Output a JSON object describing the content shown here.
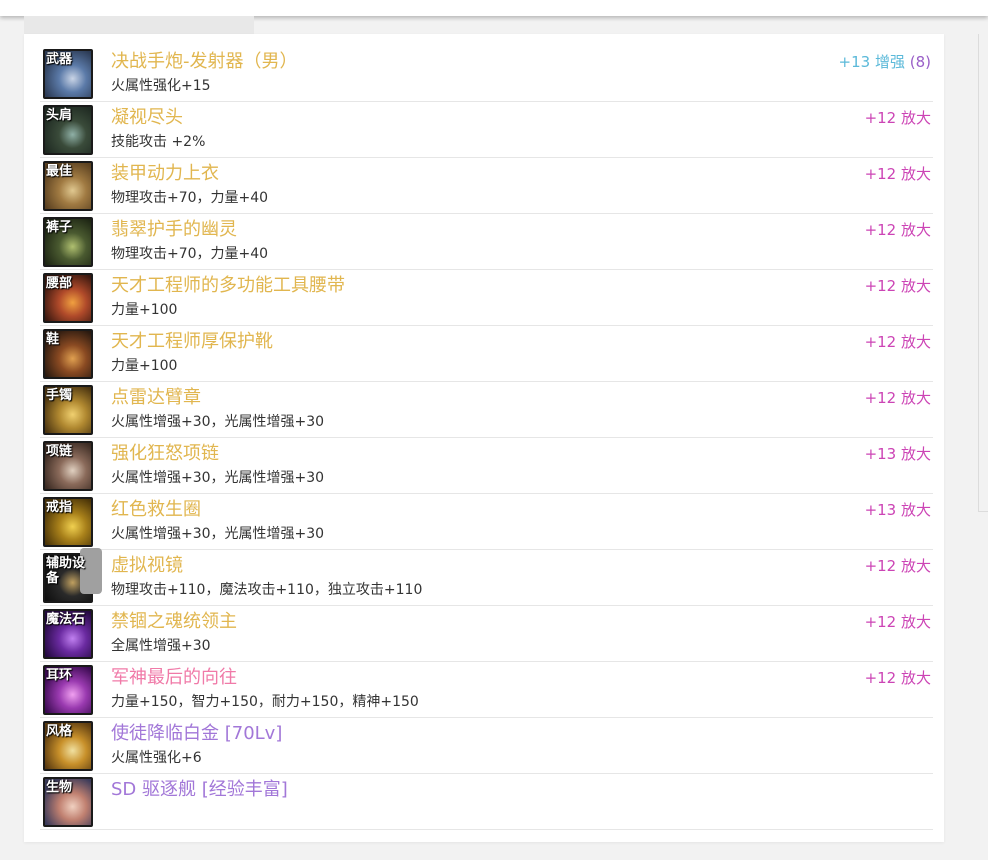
{
  "items": [
    {
      "slot": "武器",
      "name": "决战手炮-发射器（男）",
      "stat": "火属性强化+15",
      "enh_prefix": "+13 增强 ",
      "enh_count": "(8)",
      "name_color": "gold",
      "enh_color": "blue",
      "art": [
        "#5b7aa8",
        "#2c3b55",
        "#c9d4e6"
      ]
    },
    {
      "slot": "头肩",
      "name": "凝视尽头",
      "stat": "技能攻击 +2%",
      "enh_prefix": "+12 放大",
      "enh_count": "",
      "name_color": "gold",
      "enh_color": "magenta",
      "art": [
        "#3a4b3a",
        "#1f2a22",
        "#8fb0a6"
      ]
    },
    {
      "slot": "最佳",
      "name": "装甲动力上衣",
      "stat": "物理攻击+70，力量+40",
      "enh_prefix": "+12 放大",
      "enh_count": "",
      "name_color": "gold",
      "enh_color": "magenta",
      "art": [
        "#a07a42",
        "#5a4020",
        "#e0c890"
      ]
    },
    {
      "slot": "裤子",
      "name": "翡翠护手的幽灵",
      "stat": "物理攻击+70，力量+40",
      "enh_prefix": "+12 放大",
      "enh_count": "",
      "name_color": "gold",
      "enh_color": "magenta",
      "art": [
        "#4a5a30",
        "#1e2614",
        "#b0c070"
      ]
    },
    {
      "slot": "腰部",
      "name": "天才工程师的多功能工具腰带",
      "stat": "力量+100",
      "enh_prefix": "+12 放大",
      "enh_count": "",
      "name_color": "gold",
      "enh_color": "magenta",
      "art": [
        "#b04a2a",
        "#3a1810",
        "#f0a040"
      ]
    },
    {
      "slot": "鞋",
      "name": "天才工程师厚保护靴",
      "stat": "力量+100",
      "enh_prefix": "+12 放大",
      "enh_count": "",
      "name_color": "gold",
      "enh_color": "magenta",
      "art": [
        "#8a4a22",
        "#2a1a10",
        "#e0a050"
      ]
    },
    {
      "slot": "手镯",
      "name": "点雷达臂章",
      "stat": "火属性增强+30，光属性增强+30",
      "enh_prefix": "+12 放大",
      "enh_count": "",
      "name_color": "gold",
      "enh_color": "magenta",
      "art": [
        "#b08830",
        "#4a3410",
        "#f0d070"
      ]
    },
    {
      "slot": "项链",
      "name": "强化狂怒项链",
      "stat": "火属性增强+30，光属性增强+30",
      "enh_prefix": "+13 放大",
      "enh_count": "",
      "name_color": "gold",
      "enh_color": "magenta",
      "art": [
        "#8a6a5a",
        "#3a2a22",
        "#e0d0c0"
      ]
    },
    {
      "slot": "戒指",
      "name": "红色救生圈",
      "stat": "火属性增强+30，光属性增强+30",
      "enh_prefix": "+13 放大",
      "enh_count": "",
      "name_color": "gold",
      "enh_color": "magenta",
      "art": [
        "#a8801a",
        "#4a3408",
        "#f0d050"
      ]
    },
    {
      "slot": "辅助设备",
      "name": "虚拟视镜",
      "stat": "物理攻击+110，魔法攻击+110，独立攻击+110",
      "enh_prefix": "+12 放大",
      "enh_count": "",
      "name_color": "gold",
      "enh_color": "magenta",
      "art": [
        "#2a2a2a",
        "#101010",
        "#c0a060"
      ]
    },
    {
      "slot": "魔法石",
      "name": "禁锢之魂统领主",
      "stat": "全属性增强+30",
      "enh_prefix": "+12 放大",
      "enh_count": "",
      "name_color": "gold",
      "enh_color": "magenta",
      "art": [
        "#6a2aa0",
        "#240a40",
        "#c080f0"
      ]
    },
    {
      "slot": "耳环",
      "name": "军神最后的向往",
      "stat": "力量+150，智力+150，耐力+150，精神+150",
      "enh_prefix": "+12 放大",
      "enh_count": "",
      "name_color": "pink",
      "enh_color": "magenta",
      "art": [
        "#9a3ab0",
        "#3a0a50",
        "#f0a0f0"
      ]
    },
    {
      "slot": "风格",
      "name": "使徒降临白金 [70Lv]",
      "stat": "火属性强化+6",
      "enh_prefix": "",
      "enh_count": "",
      "name_color": "purple",
      "enh_color": "magenta",
      "art": [
        "#c8902a",
        "#5a3a10",
        "#f0e0a0"
      ]
    },
    {
      "slot": "生物",
      "name": "SD 驱逐舰 [经验丰富]",
      "stat": "",
      "enh_prefix": "",
      "enh_count": "",
      "name_color": "purple",
      "enh_color": "magenta",
      "art": [
        "#c08070",
        "#3a3a5a",
        "#f0d0c0"
      ]
    }
  ]
}
